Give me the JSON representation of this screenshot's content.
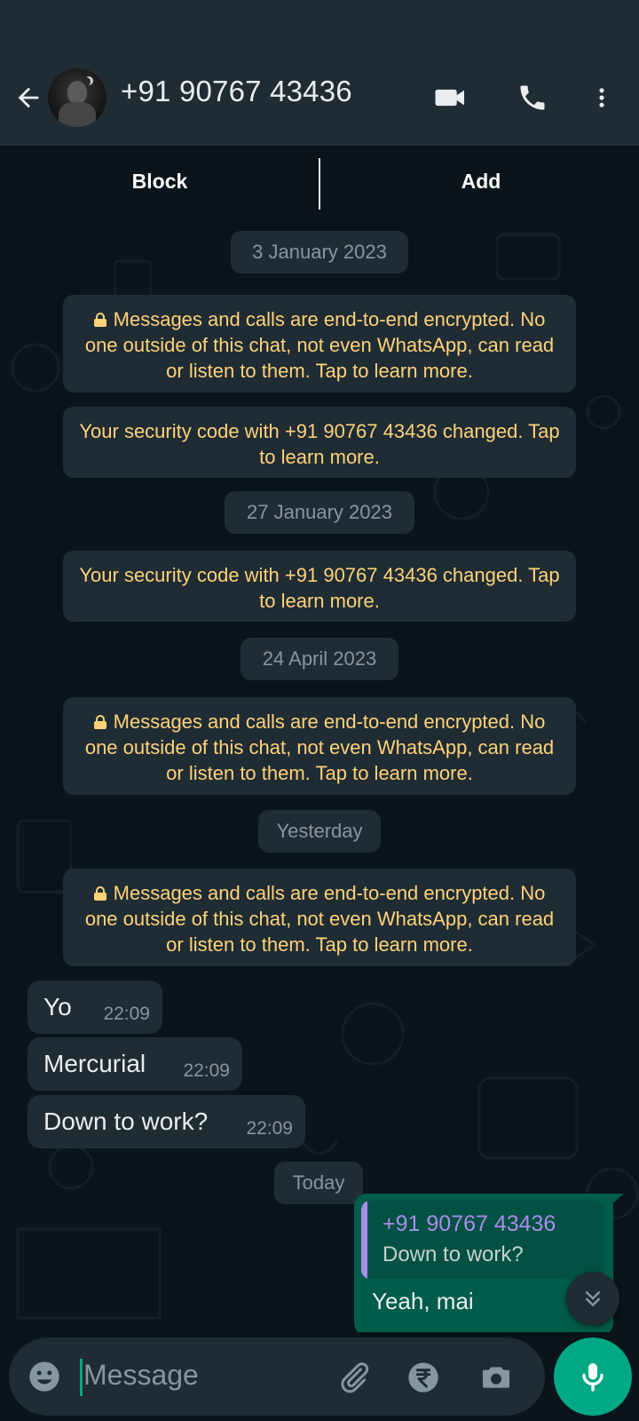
{
  "header": {
    "contact_name": "+91 90767 43436",
    "background_color": "#1f2c34"
  },
  "actions": {
    "block_label": "Block",
    "add_label": "Add"
  },
  "messages": {
    "date_1": "3 January 2023",
    "encryption_notice_1": "Messages and calls are end-to-end encrypted. No one outside of this chat, not even WhatsApp, can read or listen to them. Tap to learn more.",
    "security_notice_1": "Your security code with +91 90767 43436 changed. Tap to learn more.",
    "date_2": "27 January 2023",
    "security_notice_2": "Your security code with +91 90767 43436 changed. Tap to learn more.",
    "date_3": "24 April 2023",
    "encryption_notice_2": "Messages and calls are end-to-end encrypted. No one outside of this chat, not even WhatsApp, can read or listen to them. Tap to learn more.",
    "date_4": "Yesterday",
    "encryption_notice_3": "Messages and calls are end-to-end encrypted. No one outside of this chat, not even WhatsApp, can read or listen to them. Tap to learn more.",
    "incoming": [
      {
        "text": "Yo",
        "time": "22:09"
      },
      {
        "text": "Mercurial",
        "time": "22:09"
      },
      {
        "text": "Down to work?",
        "time": "22:09"
      }
    ],
    "date_5": "Today",
    "outgoing": {
      "quoted_name": "+91 90767 43436",
      "quoted_text": "Down to work?",
      "reply_text_partial": "Yeah, mai"
    }
  },
  "composer": {
    "placeholder": "Message"
  },
  "colors": {
    "accent": "#00a884",
    "system_text": "#ffd279",
    "bubble_in": "#1f2c34",
    "bubble_out": "#005c4b",
    "quote_name": "#a98de8"
  },
  "icons": {
    "back": "arrow-left-icon",
    "video": "video-camera-icon",
    "call": "phone-icon",
    "menu": "more-vert-icon",
    "emoji": "emoji-icon",
    "attach": "paperclip-icon",
    "payment": "rupee-icon",
    "camera": "camera-icon",
    "mic": "mic-icon",
    "scroll": "double-chevron-down-icon"
  }
}
